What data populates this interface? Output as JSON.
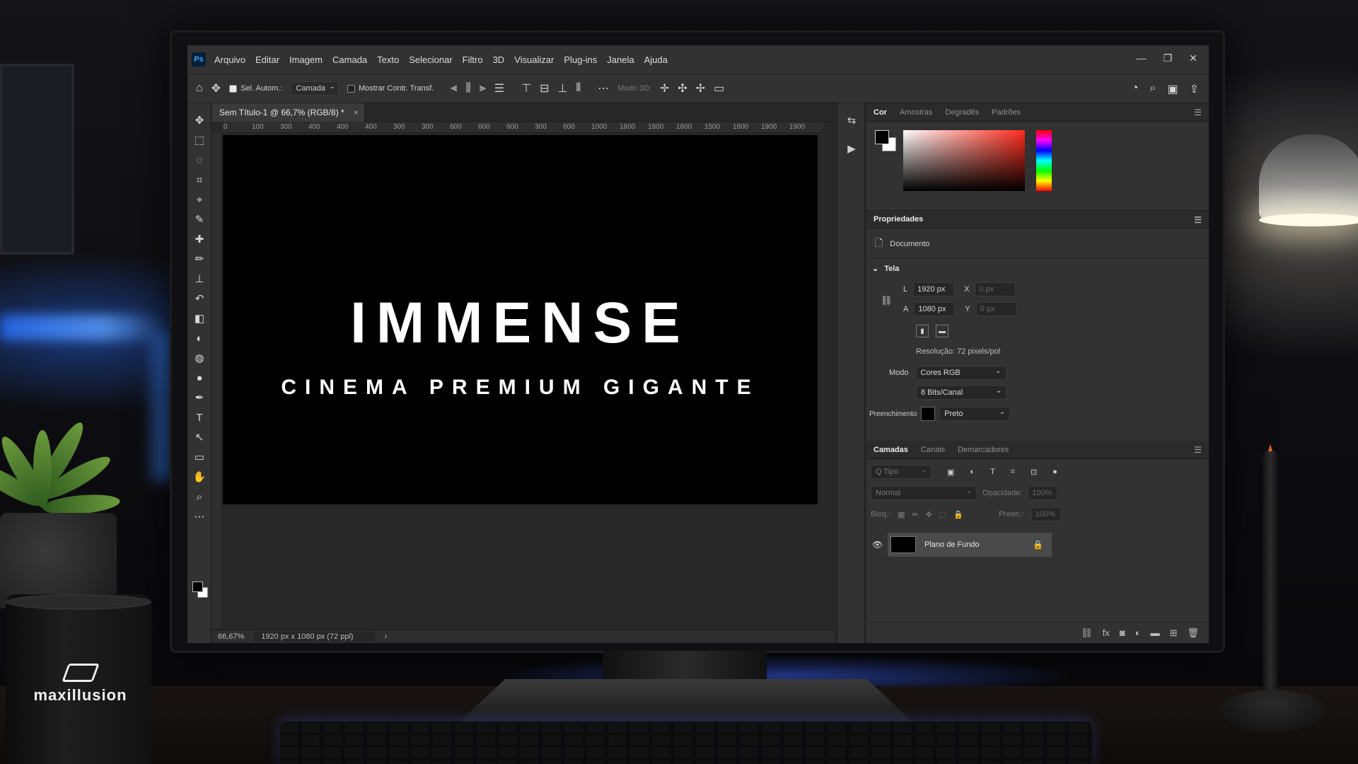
{
  "app": {
    "logo": "Ps"
  },
  "menu": [
    "Arquivo",
    "Editar",
    "Imagem",
    "Camada",
    "Texto",
    "Selecionar",
    "Filtro",
    "3D",
    "Visualizar",
    "Plug-ins",
    "Janela",
    "Ajuda"
  ],
  "window_controls": [
    "—",
    "❐",
    "✕"
  ],
  "options": {
    "auto_select_label": "Sel. Autom.:",
    "auto_select_value": "Camada",
    "show_transform_label": "Mostrar Contr. Transf.",
    "mode3d_label": "Modo 3D:"
  },
  "document": {
    "tab_title": "Sem Título-1 @ 66,7% (RGB/8) *",
    "close": "×",
    "zoom": "66,67%",
    "doc_info": "1920 px x 1080 px (72 ppl)",
    "ruler_top": [
      "0",
      "100",
      "300",
      "400",
      "400",
      "400",
      "300",
      "300",
      "600",
      "600",
      "600",
      "300",
      "600",
      "1000",
      "1800",
      "1800",
      "1800",
      "1500",
      "1800",
      "1900",
      "1900"
    ]
  },
  "canvas": {
    "title": "IMMENSE",
    "subtitle": "CINEMA PREMIUM GIGANTE"
  },
  "panels": {
    "color_tabs": [
      "Cor",
      "Amostras",
      "Degradês",
      "Padrões"
    ],
    "properties_title": "Propriedades",
    "document_label": "Documento",
    "canvas_section": "Tela",
    "width_label": "L",
    "width_value": "1920 px",
    "height_label": "A",
    "height_value": "1080 px",
    "x_label": "X",
    "x_value": "0 px",
    "y_label": "Y",
    "y_value": "0 px",
    "resolution": "Resolução: 72 pixels/pol",
    "mode_label": "Modo",
    "mode_value": "Cores RGB",
    "bits_value": "8 Bits/Canal",
    "fill_label": "Preenchimento",
    "fill_value": "Preto",
    "layer_tabs": [
      "Camadas",
      "Canais",
      "Demarcadores"
    ],
    "search_placeholder": "Q  Tipo",
    "blend_mode": "Normal",
    "opacity_label": "Opacidade:",
    "opacity_value": "100%",
    "lock_label": "Bloq.:",
    "fill_pct_label": "Preen.:",
    "fill_pct_value": "100%",
    "layer_name": "Plano de Fundo"
  },
  "mug": {
    "brand": "maxillusion"
  },
  "colors": {
    "canvas": "#000000",
    "panel": "#323232",
    "accent_ps": "#31a8ff"
  }
}
